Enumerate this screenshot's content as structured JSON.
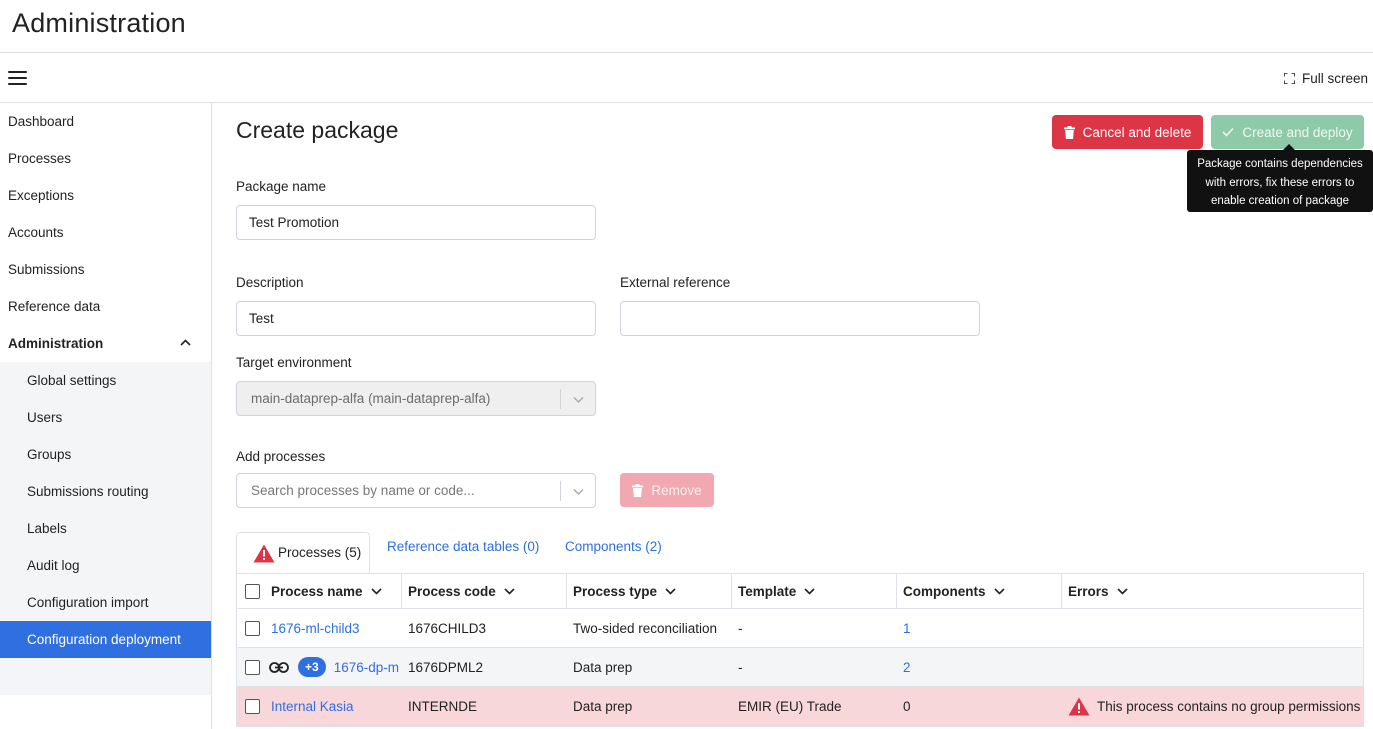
{
  "app": {
    "title": "Administration"
  },
  "toolbar": {
    "fullscreen_label": "Full screen"
  },
  "sidebar": {
    "items": [
      {
        "label": "Dashboard"
      },
      {
        "label": "Processes"
      },
      {
        "label": "Exceptions"
      },
      {
        "label": "Accounts"
      },
      {
        "label": "Submissions"
      },
      {
        "label": "Reference data"
      },
      {
        "label": "Administration"
      }
    ],
    "subitems": [
      {
        "label": "Global settings"
      },
      {
        "label": "Users"
      },
      {
        "label": "Groups"
      },
      {
        "label": "Submissions routing"
      },
      {
        "label": "Labels"
      },
      {
        "label": "Audit log"
      },
      {
        "label": "Configuration import"
      },
      {
        "label": "Configuration deployment"
      }
    ]
  },
  "page": {
    "title": "Create package",
    "cancel_label": "Cancel and delete",
    "create_label": "Create and deploy",
    "tooltip_line1": "Package contains dependencies",
    "tooltip_line2": "with errors, fix these errors to",
    "tooltip_line3": "enable creation of package"
  },
  "form": {
    "package_name_label": "Package name",
    "package_name_value": "Test Promotion",
    "description_label": "Description",
    "description_value": "Test",
    "external_ref_label": "External reference",
    "external_ref_value": "",
    "target_env_label": "Target environment",
    "target_env_value": "main-dataprep-alfa (main-dataprep-alfa)",
    "add_processes_label": "Add processes",
    "add_processes_placeholder": "Search processes by name or code...",
    "remove_label": "Remove"
  },
  "tabs": [
    {
      "label": "Processes (5)"
    },
    {
      "label": "Reference data tables (0)"
    },
    {
      "label": "Components (2)"
    }
  ],
  "table": {
    "headers": [
      "Process name",
      "Process code",
      "Process type",
      "Template",
      "Components",
      "Errors"
    ],
    "rows": [
      {
        "name": "1676-ml-child3",
        "code": "1676CHILD3",
        "type": "Two-sided reconciliation",
        "template": "-",
        "components": "1",
        "error": ""
      },
      {
        "name": "1676-dp-m",
        "badge": "+3",
        "code": "1676DPML2",
        "type": "Data prep",
        "template": "-",
        "components": "2",
        "error": ""
      },
      {
        "name": "Internal Kasia",
        "code": "INTERNDE",
        "type": "Data prep",
        "template": "EMIR (EU) Trade",
        "components": "0",
        "error": "This process contains no group permissions"
      }
    ]
  },
  "colors": {
    "accent": "#2f6fe0",
    "danger": "#dc3545",
    "success_disabled": "#8fcaa8",
    "error_row": "#f8d7da"
  },
  "icons": [
    "hamburger-icon",
    "fullscreen-icon",
    "chevron-up-icon",
    "trash-icon",
    "check-icon",
    "chevron-down-icon",
    "warning-icon",
    "link-icon"
  ]
}
